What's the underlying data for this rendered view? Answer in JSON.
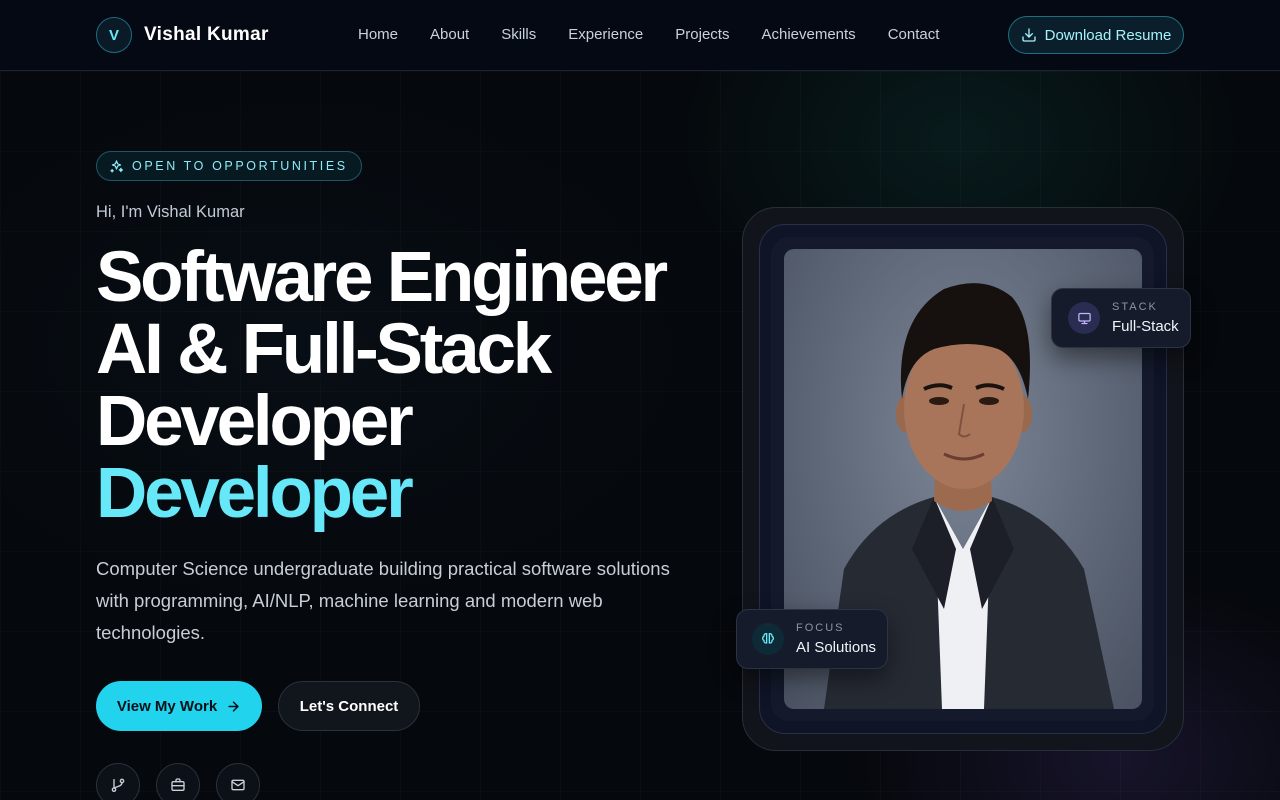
{
  "brand": {
    "logo_letter": "V",
    "name": "Vishal Kumar"
  },
  "nav": {
    "links": [
      "Home",
      "About",
      "Skills",
      "Experience",
      "Projects",
      "Achievements",
      "Contact"
    ],
    "resume_label": "Download Resume"
  },
  "hero": {
    "badge": "OPEN TO OPPORTUNITIES",
    "greeting": "Hi, I'm Vishal Kumar",
    "headline_lines": [
      "Software Engineer",
      "AI & Full-Stack",
      "Developer"
    ],
    "headline_accent": "Developer",
    "description": "Computer Science undergraduate building practical software solutions with programming, AI/NLP, machine learning and modern web technologies.",
    "primary_cta": "View My Work",
    "secondary_cta": "Let's Connect",
    "social_icons": [
      "git-branch-icon",
      "briefcase-icon",
      "mail-icon"
    ]
  },
  "cards": {
    "stack": {
      "label": "STACK",
      "value": "Full-Stack",
      "icon": "monitor-icon"
    },
    "focus": {
      "label": "FOCUS",
      "value": "AI Solutions",
      "icon": "brain-icon"
    }
  },
  "colors": {
    "background": "#05080c",
    "accent": "#22d3ee",
    "accent_text": "#67e8f9",
    "card": "#161b2b"
  }
}
